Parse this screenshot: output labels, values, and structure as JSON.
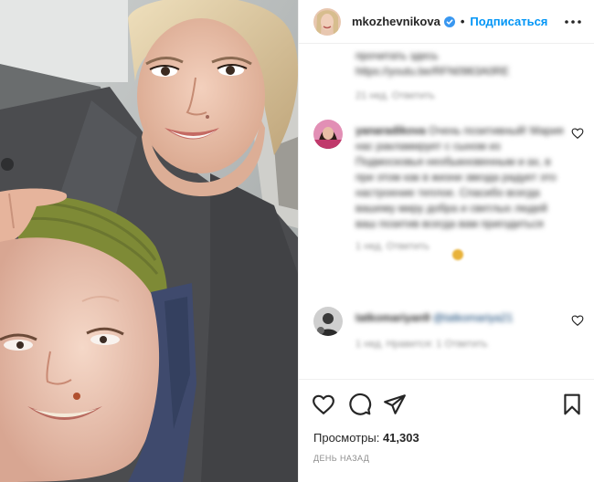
{
  "post": {
    "username": "mkozhevnikova",
    "follow_label": "Подписаться",
    "separator": "•",
    "views_label": "Просмотры:",
    "views_count": "41,303",
    "date_label": "ДЕНЬ НАЗАД"
  },
  "comments": [
    {
      "username": "",
      "text": "прочитать здесь https://youtu.be/RFN0963A0RE",
      "meta": "21 нед.   Ответить",
      "blurred": true
    },
    {
      "username": "yanaradikova",
      "text": "Очень позитивный! Мария нас ракламирует с сыном из Подмосковья необыкновенным и ах, в при этом как в жизни звезда радует это настроение теплое. Спасибо всегда вашему миру добра и светлых людей ваш позитив всегда вам пригодиться",
      "meta": "1 нед.   Ответить",
      "blurred": true
    },
    {
      "username": "tatkomariyan9",
      "text": "@tatkomariya21",
      "meta": "1 нед.   Нравится: 1   Ответить",
      "blurred": true
    }
  ],
  "icons": {
    "verified": "verified-badge-icon",
    "more": "more-options-icon",
    "like": "heart-icon",
    "comment": "comment-icon",
    "share": "paper-plane-icon",
    "save": "bookmark-icon"
  },
  "colors": {
    "accent": "#0095f6",
    "text": "#262626",
    "muted": "#8e8e8e",
    "border": "#efefef"
  }
}
